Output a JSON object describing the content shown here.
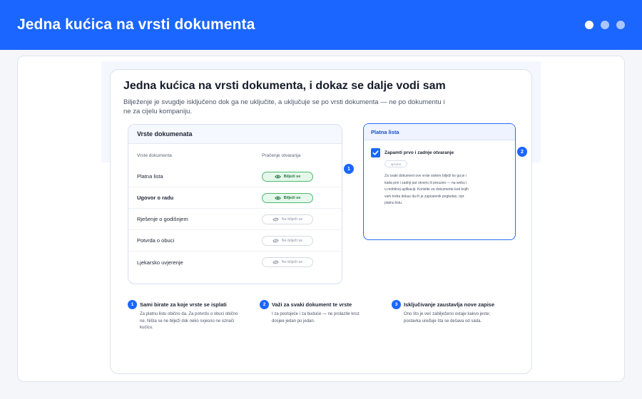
{
  "banner": {
    "title": "Jedna kućica na vrsti dokumenta"
  },
  "page": {
    "title": "Jedna kućica na vrsti dokumenta, i dokaz se dalje vodi sam",
    "subtitle": "Bilježenje je svugdje isključeno dok ga ne uključite, a uključuje se po vrsti dokumenta — ne po dokumentu i ne za cijelu kompaniju."
  },
  "types_card": {
    "title": "Vrste dokumenata",
    "col_type": "Vrste dokumenta",
    "col_tracking": "Praćenje otvaranja",
    "rows": [
      {
        "name": "Platna lista",
        "state": "Bilježi se",
        "on": true
      },
      {
        "name": "Ugovor o radu",
        "state": "Bilježi se",
        "on": true
      },
      {
        "name": "Rješenje o godišnjem",
        "state": "Ne bilježi se",
        "on": false
      },
      {
        "name": "Potvrda o obuci",
        "state": "Ne bilježi se",
        "on": false
      },
      {
        "name": "Ljekarsko uvjerenje",
        "state": "Ne bilježi se",
        "on": false
      }
    ]
  },
  "badges": {
    "one": "1",
    "two": "2",
    "three": "3"
  },
  "detail_card": {
    "title": "Platna lista",
    "checkbox_label": "Zapamti prvo i zadnje otvaranje",
    "checked": true,
    "pill": "opcono",
    "description": "Za svaki dokument ove vrste sistem bilježi ko ga je i kada prvi i zadnji put otvorio ili preuzeo — na webu i u mobilnoj aplikaciji. Koristite za dokumente kod kojih vam treba dokaz da ih je zaposlenik pogledao, npr. platnu listu."
  },
  "notes": [
    {
      "title": "Sami birate za koje vrste se isplati",
      "text": "Za platnu listu obično da. Za potvrdu o obuci obično ne. Ništa se ne bilježi dok neko svjesno ne označi kućicu."
    },
    {
      "title": "Važi za svaki dokument te vrste",
      "text": "I za postojeće i za buduće — ne prolazite kroz dosjee jedan po jedan."
    },
    {
      "title": "Isključivanje zaustavlja nove zapise",
      "text": "Ono što je već zabilježeno ostaje kakvo jeste; postavka uređuje šta se dešava od sada."
    }
  ],
  "colors": {
    "brand": "#1a66ff",
    "on_green": "#4bb96e",
    "on_bg": "#e6f7ec"
  }
}
